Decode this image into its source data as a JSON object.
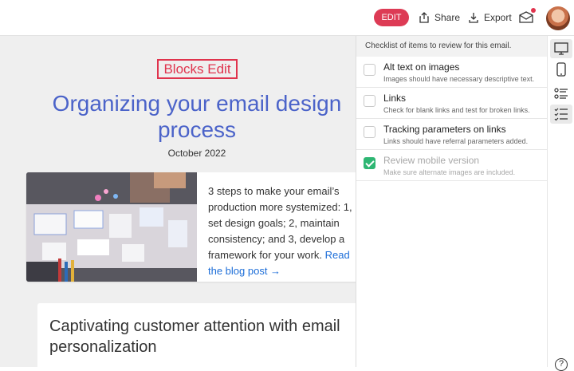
{
  "toolbar": {
    "edit_label": "EDIT",
    "share_label": "Share",
    "export_label": "Export",
    "inbox_icon": "inbox-icon",
    "notification": true
  },
  "email": {
    "brand": "Blocks Edit",
    "title": "Organizing your email design process",
    "date": "October 2022",
    "card_text": "3 steps to make your email’s production more systemized: 1, set design goals; 2, maintain consistency; and 3, develop a framework for your work.",
    "card_link": "Read the blog post →",
    "second_heading": "Captivating customer attention with email personalization"
  },
  "checklist": {
    "header": "Checklist of items to review for this email.",
    "items": [
      {
        "label": "Alt text on images",
        "sub": "Images should have necessary descriptive text.",
        "checked": false
      },
      {
        "label": "Links",
        "sub": "Check for blank links and test for broken links.",
        "checked": false
      },
      {
        "label": "Tracking parameters on links",
        "sub": "Links should have referral parameters added.",
        "checked": false
      },
      {
        "label": "Review mobile version",
        "sub": "Make sure alternate images are included.",
        "checked": true
      }
    ]
  },
  "rail": {
    "icons": [
      "desktop-icon",
      "mobile-icon",
      "list-icon",
      "checklist-icon"
    ],
    "help": "?"
  },
  "colors": {
    "accent": "#dd3b55",
    "title_blue": "#4b63c9",
    "link_blue": "#1d6ed8",
    "check_green": "#2eb673"
  }
}
